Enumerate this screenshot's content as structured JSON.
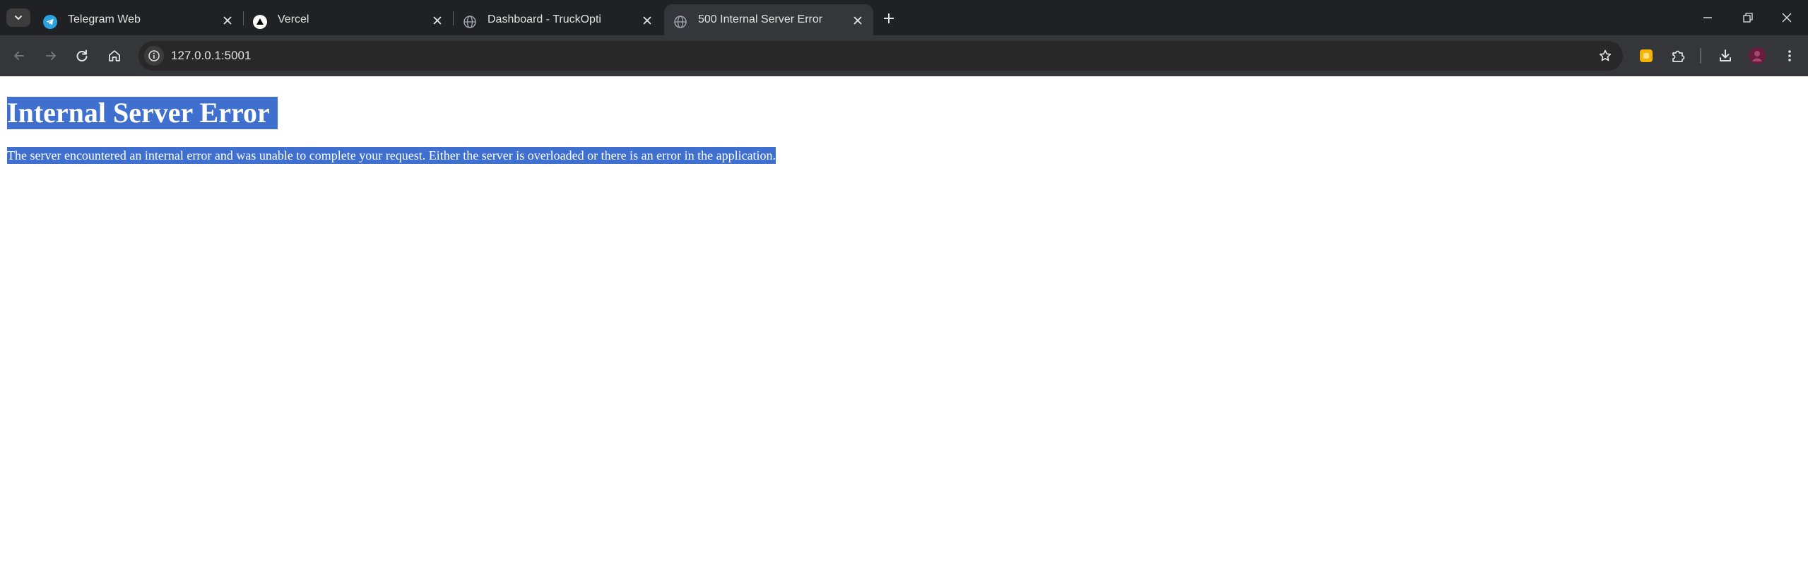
{
  "browser": {
    "tabs": [
      {
        "title": "Telegram Web",
        "favicon": "telegram-icon",
        "active": false
      },
      {
        "title": "Vercel",
        "favicon": "vercel-icon",
        "active": false
      },
      {
        "title": "Dashboard - TruckOpti",
        "favicon": "globe-icon",
        "active": false
      },
      {
        "title": "500 Internal Server Error",
        "favicon": "globe-icon",
        "active": true
      }
    ],
    "url": "127.0.0.1:5001"
  },
  "page": {
    "heading": "Internal Server Error",
    "message": "The server encountered an internal error and was unable to complete your request. Either the server is overloaded or there is an error in the application."
  },
  "colors": {
    "titlebar": "#202124",
    "toolbar": "#35363a",
    "omnibox": "#282828",
    "selection": "#3f70cf",
    "telegram": "#2aa3e0",
    "extension": "#f6b400",
    "avatar": "#6a1b3a"
  }
}
